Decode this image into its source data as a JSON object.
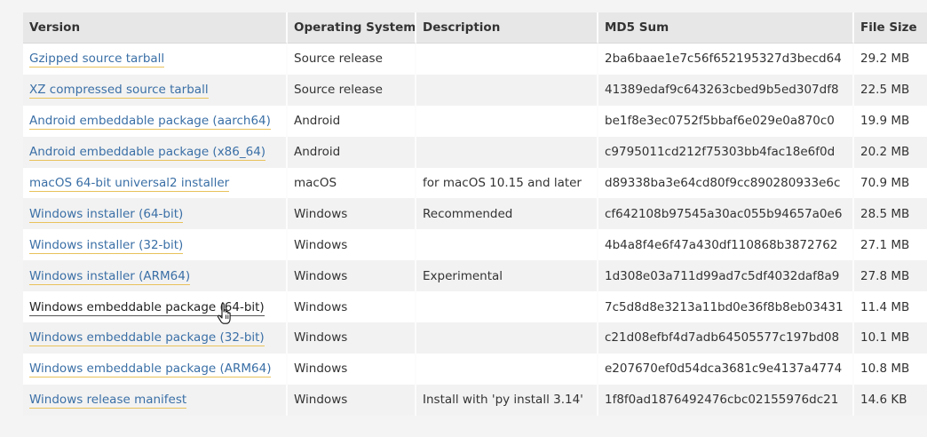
{
  "table": {
    "headers": {
      "version": "Version",
      "os": "Operating System",
      "description": "Description",
      "md5": "MD5 Sum",
      "size": "File Size"
    },
    "rows": [
      {
        "version": "Gzipped source tarball",
        "os": "Source release",
        "description": "",
        "md5": "2ba6baae1e7c56f652195327d3becd64",
        "size": "29.2 MB"
      },
      {
        "version": "XZ compressed source tarball",
        "os": "Source release",
        "description": "",
        "md5": "41389edaf9c643263cbed9b5ed307df8",
        "size": "22.5 MB"
      },
      {
        "version": "Android embeddable package (aarch64)",
        "os": "Android",
        "description": "",
        "md5": "be1f8e3ec0752f5bbaf6e029e0a870c0",
        "size": "19.9 MB"
      },
      {
        "version": "Android embeddable package (x86_64)",
        "os": "Android",
        "description": "",
        "md5": "c9795011cd212f75303bb4fac18e6f0d",
        "size": "20.2 MB"
      },
      {
        "version": "macOS 64-bit universal2 installer",
        "os": "macOS",
        "description": "for macOS 10.15 and later",
        "md5": "d89338ba3e64cd80f9cc890280933e6c",
        "size": "70.9 MB"
      },
      {
        "version": "Windows installer (64-bit)",
        "os": "Windows",
        "description": "Recommended",
        "md5": "cf642108b97545a30ac055b94657a0e6",
        "size": "28.5 MB"
      },
      {
        "version": "Windows installer (32-bit)",
        "os": "Windows",
        "description": "",
        "md5": "4b4a8f4e6f47a430df110868b3872762",
        "size": "27.1 MB"
      },
      {
        "version": "Windows installer (ARM64)",
        "os": "Windows",
        "description": "Experimental",
        "md5": "1d308e03a711d99ad7c5df4032daf8a9",
        "size": "27.8 MB"
      },
      {
        "version": "Windows embeddable package (64-bit)",
        "os": "Windows",
        "description": "",
        "md5": "7c5d8d8e3213a11bd0e36f8b8eb03431",
        "size": "11.4 MB"
      },
      {
        "version": "Windows embeddable package (32-bit)",
        "os": "Windows",
        "description": "",
        "md5": "c21d08efbf4d7adb64505577c197bd08",
        "size": "10.1 MB"
      },
      {
        "version": "Windows embeddable package (ARM64)",
        "os": "Windows",
        "description": "",
        "md5": "e207670ef0d54dca3681c9e4137a4774",
        "size": "10.8 MB"
      },
      {
        "version": "Windows release manifest",
        "os": "Windows",
        "description": "Install with 'py install 3.14'",
        "md5": "1f8f0ad1876492476cbc02155976dc21",
        "size": "14.6 KB"
      }
    ]
  },
  "hovered_row": 8,
  "cursor_icon": "hand-pointer-icon",
  "colors": {
    "link": "#3a6fa6",
    "link_underline": "#e8c25a",
    "header_bg": "#e7e7e7",
    "row_alt_bg": "#f2f2f2"
  }
}
